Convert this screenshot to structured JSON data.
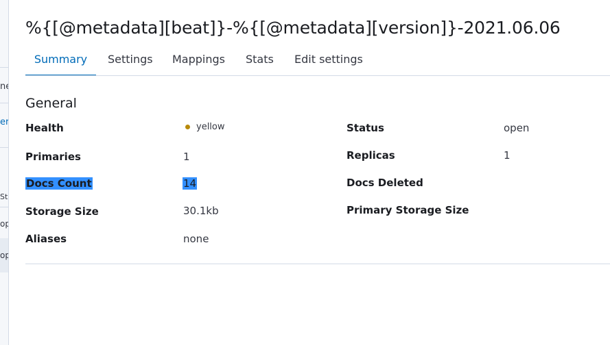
{
  "background": {
    "fragments": [
      "ne",
      "err",
      "Sta",
      "op",
      "op"
    ]
  },
  "index": {
    "title": "%{[@metadata][beat]}-%{[@metadata][version]}-2021.06.06"
  },
  "tabs": [
    {
      "label": "Summary",
      "active": true
    },
    {
      "label": "Settings",
      "active": false
    },
    {
      "label": "Mappings",
      "active": false
    },
    {
      "label": "Stats",
      "active": false
    },
    {
      "label": "Edit settings",
      "active": false
    }
  ],
  "general": {
    "title": "General",
    "health_label": "Health",
    "health_value": "yellow",
    "health_color": "#b88a0b",
    "status_label": "Status",
    "status_value": "open",
    "primaries_label": "Primaries",
    "primaries_value": "1",
    "replicas_label": "Replicas",
    "replicas_value": "1",
    "docs_count_label": "Docs Count",
    "docs_count_value": "14",
    "docs_deleted_label": "Docs Deleted",
    "storage_size_label": "Storage Size",
    "storage_size_value": "30.1kb",
    "primary_storage_size_label": "Primary Storage Size",
    "aliases_label": "Aliases",
    "aliases_value": "none"
  },
  "colors": {
    "accent": "#006bb8",
    "selection": "#3390ff"
  }
}
